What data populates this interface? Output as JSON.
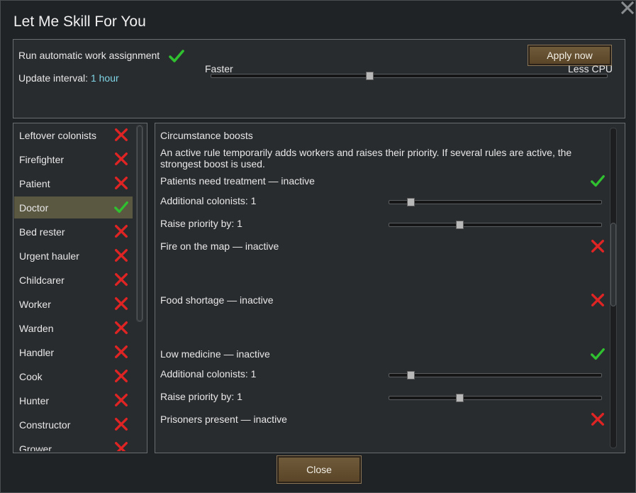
{
  "window": {
    "title": "Let Me Skill For You"
  },
  "top": {
    "run_label": "Run automatic work assignment",
    "run_enabled": true,
    "interval_label": "Update interval:",
    "interval_value": "1 hour",
    "apply_label": "Apply now",
    "slider_left_label": "Faster",
    "slider_right_label": "Less CPU",
    "slider_value": 0.4
  },
  "roles": [
    {
      "label": "Leftover colonists",
      "enabled": false,
      "selected": false
    },
    {
      "label": "Firefighter",
      "enabled": false,
      "selected": false
    },
    {
      "label": "Patient",
      "enabled": false,
      "selected": false
    },
    {
      "label": "Doctor",
      "enabled": true,
      "selected": true
    },
    {
      "label": "Bed rester",
      "enabled": false,
      "selected": false
    },
    {
      "label": "Urgent hauler",
      "enabled": false,
      "selected": false
    },
    {
      "label": "Childcarer",
      "enabled": false,
      "selected": false
    },
    {
      "label": "Worker",
      "enabled": false,
      "selected": false
    },
    {
      "label": "Warden",
      "enabled": false,
      "selected": false
    },
    {
      "label": "Handler",
      "enabled": false,
      "selected": false
    },
    {
      "label": "Cook",
      "enabled": false,
      "selected": false
    },
    {
      "label": "Hunter",
      "enabled": false,
      "selected": false
    },
    {
      "label": "Constructor",
      "enabled": false,
      "selected": false
    },
    {
      "label": "Grower",
      "enabled": false,
      "selected": false
    }
  ],
  "boosts": {
    "heading": "Circumstance boosts",
    "description_line1": "An active rule temporarily adds workers and raises their priority. If several rules are active, the",
    "description_line2": "strongest boost is used.",
    "rules": [
      {
        "label": "Patients need treatment — inactive",
        "enabled": true,
        "additional_label": "Additional colonists: 1",
        "additional_value": 0.1,
        "priority_label": "Raise priority by: 1",
        "priority_value": 0.33
      },
      {
        "label": "Fire on the map — inactive",
        "enabled": false
      },
      {
        "label": "Food shortage — inactive",
        "enabled": false
      },
      {
        "label": "Low medicine — inactive",
        "enabled": true,
        "additional_label": "Additional colonists: 1",
        "additional_value": 0.1,
        "priority_label": "Raise priority by: 1",
        "priority_value": 0.33
      },
      {
        "label": "Prisoners present — inactive",
        "enabled": false
      }
    ]
  },
  "footer": {
    "close_label": "Close"
  },
  "colors": {
    "check": "#2fc12f",
    "cross": "#e02424",
    "accent": "#7fd6e6",
    "button": "#6a5434"
  }
}
